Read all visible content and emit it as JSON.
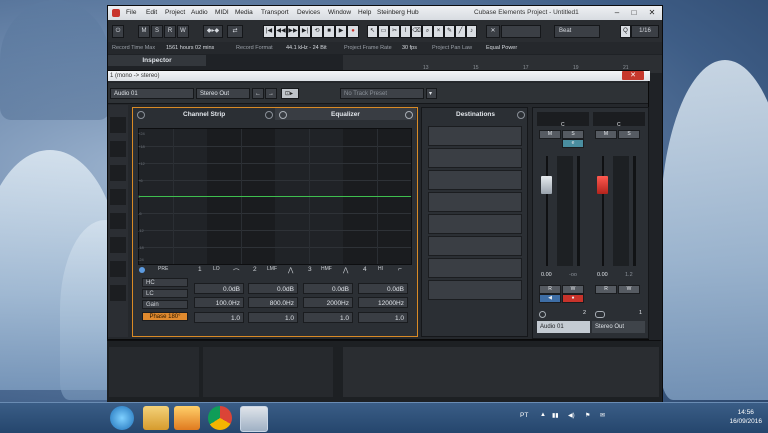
{
  "app": {
    "title": "Cubase Elements Project - Untitled1",
    "menu": [
      "File",
      "Edit",
      "Project",
      "Audio",
      "MIDI",
      "Media",
      "Transport",
      "Devices",
      "Window",
      "Help",
      "Steinberg Hub"
    ]
  },
  "toolbar": {
    "mode_buttons": [
      "M",
      "S",
      "R",
      "W"
    ],
    "snap_value": "Beat",
    "quantize": "1/16",
    "quantize_icon": "Q"
  },
  "status_bar": {
    "record_time_label": "Record Time Max",
    "record_time_value": "1561 hours 02 mins",
    "record_format_label": "Record Format",
    "record_format_value": "44.1 kHz - 24 Bit",
    "frame_rate_label": "Project Frame Rate",
    "frame_rate_value": "30 fps",
    "pan_law_label": "Project Pan Law",
    "pan_law_value": "Equal Power"
  },
  "inspector": {
    "title": "Inspector"
  },
  "ruler_ticks": [
    "13",
    "15",
    "17",
    "19",
    "21"
  ],
  "dialog": {
    "title": "1 (mono -> stereo)",
    "channel_name": "Audio 01",
    "output": "Stereo Out",
    "preset": "No Track Preset"
  },
  "channel_strip": {
    "title": "Channel Strip"
  },
  "equalizer": {
    "title": "Equalizer",
    "y_labels": [
      "+24",
      "+18",
      "+12",
      "+6",
      "0",
      "-6",
      "-12",
      "-18",
      "-24"
    ],
    "pre_label": "PRE",
    "side_buttons": {
      "hc": "HC",
      "lc": "LC",
      "gain": "Gain",
      "phase": "Phase 180°"
    },
    "bands": [
      {
        "num": "1",
        "type": "LO",
        "gain": "0.0dB",
        "freq": "100.0Hz",
        "q": "1.0"
      },
      {
        "num": "2",
        "type": "LMF",
        "gain": "0.0dB",
        "freq": "800.0Hz",
        "q": "1.0"
      },
      {
        "num": "3",
        "type": "HMF",
        "gain": "0.0dB",
        "freq": "2000Hz",
        "q": "1.0"
      },
      {
        "num": "4",
        "type": "HI",
        "gain": "0.0dB",
        "freq": "12000Hz",
        "q": "1.0"
      }
    ]
  },
  "destinations": {
    "title": "Destinations"
  },
  "mixer": {
    "left": {
      "pan": "C",
      "value": "0.00",
      "vu": "-oo",
      "name": "Audio 01",
      "index": "2"
    },
    "right": {
      "pan": "C",
      "value": "0.00",
      "vu": "1.2",
      "name": "Stereo Out",
      "index": "1"
    },
    "buttons": {
      "m": "M",
      "s": "S",
      "e": "e",
      "r": "R",
      "w": "W"
    },
    "scale": [
      "6",
      "0",
      "-3",
      "-6",
      "-12",
      "-18",
      "-24",
      "-30",
      "-40",
      "-50",
      "-60"
    ]
  },
  "taskbar": {
    "lang": "PT",
    "time": "14:56",
    "date": "16/09/2016"
  }
}
